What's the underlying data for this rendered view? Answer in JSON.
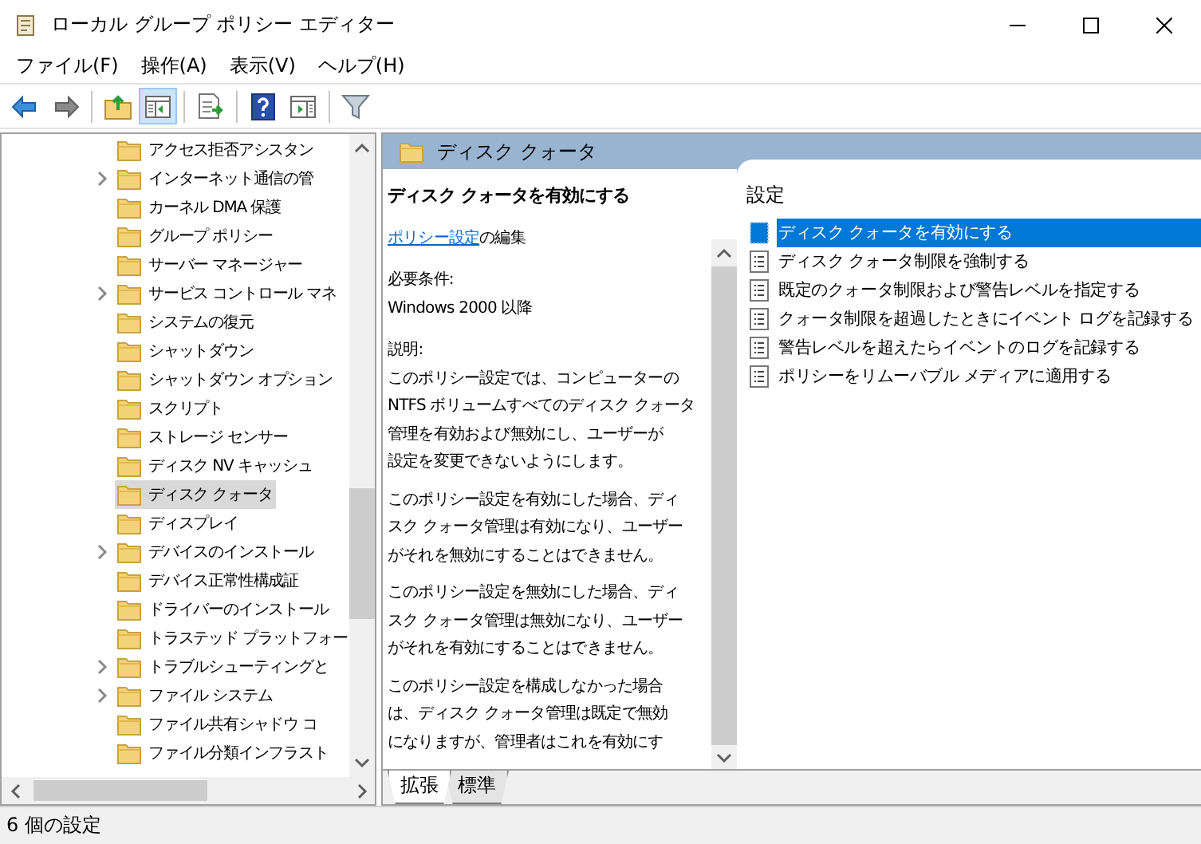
{
  "window": {
    "title": "ローカル グループ ポリシー エディター"
  },
  "menu": [
    "ファイル(F)",
    "操作(A)",
    "表示(V)",
    "ヘルプ(H)"
  ],
  "toolbar": [
    [
      {
        "kind": "back",
        "pressed": false
      },
      {
        "kind": "forward",
        "pressed": false
      }
    ],
    [
      {
        "kind": "up",
        "pressed": false
      },
      {
        "kind": "tree",
        "pressed": true
      }
    ],
    [
      {
        "kind": "export",
        "pressed": false
      }
    ],
    [
      {
        "kind": "help",
        "pressed": false
      },
      {
        "kind": "pane",
        "pressed": false
      }
    ],
    [
      {
        "kind": "filter",
        "pressed": false
      }
    ]
  ],
  "tree": {
    "items": [
      {
        "label": "アクセス拒否アシスタン",
        "expandable": false,
        "selected": false
      },
      {
        "label": "インターネット通信の管",
        "expandable": true,
        "selected": false
      },
      {
        "label": "カーネル DMA 保護",
        "expandable": false,
        "selected": false
      },
      {
        "label": "グループ ポリシー",
        "expandable": false,
        "selected": false
      },
      {
        "label": "サーバー マネージャー",
        "expandable": false,
        "selected": false
      },
      {
        "label": "サービス コントロール マネ",
        "expandable": true,
        "selected": false
      },
      {
        "label": "システムの復元",
        "expandable": false,
        "selected": false
      },
      {
        "label": "シャットダウン",
        "expandable": false,
        "selected": false
      },
      {
        "label": "シャットダウン オプション",
        "expandable": false,
        "selected": false
      },
      {
        "label": "スクリプト",
        "expandable": false,
        "selected": false
      },
      {
        "label": "ストレージ センサー",
        "expandable": false,
        "selected": false
      },
      {
        "label": "ディスク NV キャッシュ",
        "expandable": false,
        "selected": false
      },
      {
        "label": "ディスク クォータ",
        "expandable": false,
        "selected": true
      },
      {
        "label": "ディスプレイ",
        "expandable": false,
        "selected": false
      },
      {
        "label": "デバイスのインストール",
        "expandable": true,
        "selected": false
      },
      {
        "label": "デバイス正常性構成証",
        "expandable": false,
        "selected": false
      },
      {
        "label": "ドライバーのインストール",
        "expandable": false,
        "selected": false
      },
      {
        "label": "トラステッド プラットフォー",
        "expandable": false,
        "selected": false
      },
      {
        "label": "トラブルシューティングと",
        "expandable": true,
        "selected": false
      },
      {
        "label": "ファイル システム",
        "expandable": true,
        "selected": false
      },
      {
        "label": "ファイル共有シャドウ コ",
        "expandable": false,
        "selected": false
      },
      {
        "label": "ファイル分類インフラスト",
        "expandable": false,
        "selected": false
      }
    ]
  },
  "detail": {
    "heading": "ディスク クォータ",
    "title": "ディスク クォータを有効にする",
    "edit_link": "ポリシー設定",
    "edit_suffix": "の編集",
    "requirements_label": "必要条件:",
    "requirements": "Windows 2000 以降",
    "description_label": "説明:",
    "paragraphs": [
      [
        "このポリシー設定では、コンピューターの",
        "NTFS ボリュームすべてのディスク クォータ",
        "管理を有効および無効にし、ユーザーが",
        "設定を変更できないようにします。"
      ],
      [
        "このポリシー設定を有効にした場合、ディ",
        "スク クォータ管理は有効になり、ユーザー",
        "がそれを無効にすることはできません。"
      ],
      [
        "このポリシー設定を無効にした場合、ディ",
        "スク クォータ管理は無効になり、ユーザー",
        "がそれを有効にすることはできません。"
      ],
      [
        "このポリシー設定を構成しなかった場合",
        "は、ディスク クォータ管理は既定で無効",
        "になりますが、管理者はこれを有効にす"
      ]
    ]
  },
  "settings": {
    "column": "設定",
    "items": [
      {
        "label": "ディスク クォータを有効にする",
        "selected": true
      },
      {
        "label": "ディスク クォータ制限を強制する",
        "selected": false
      },
      {
        "label": "既定のクォータ制限および警告レベルを指定する",
        "selected": false
      },
      {
        "label": "クォータ制限を超過したときにイベント ログを記録する",
        "selected": false
      },
      {
        "label": "警告レベルを超えたらイベントのログを記録する",
        "selected": false
      },
      {
        "label": "ポリシーをリムーバブル メディアに適用する",
        "selected": false
      }
    ]
  },
  "tabs": [
    {
      "label": "拡張",
      "selected": true
    },
    {
      "label": "標準",
      "selected": false
    }
  ],
  "status_bar": "6 個の設定"
}
